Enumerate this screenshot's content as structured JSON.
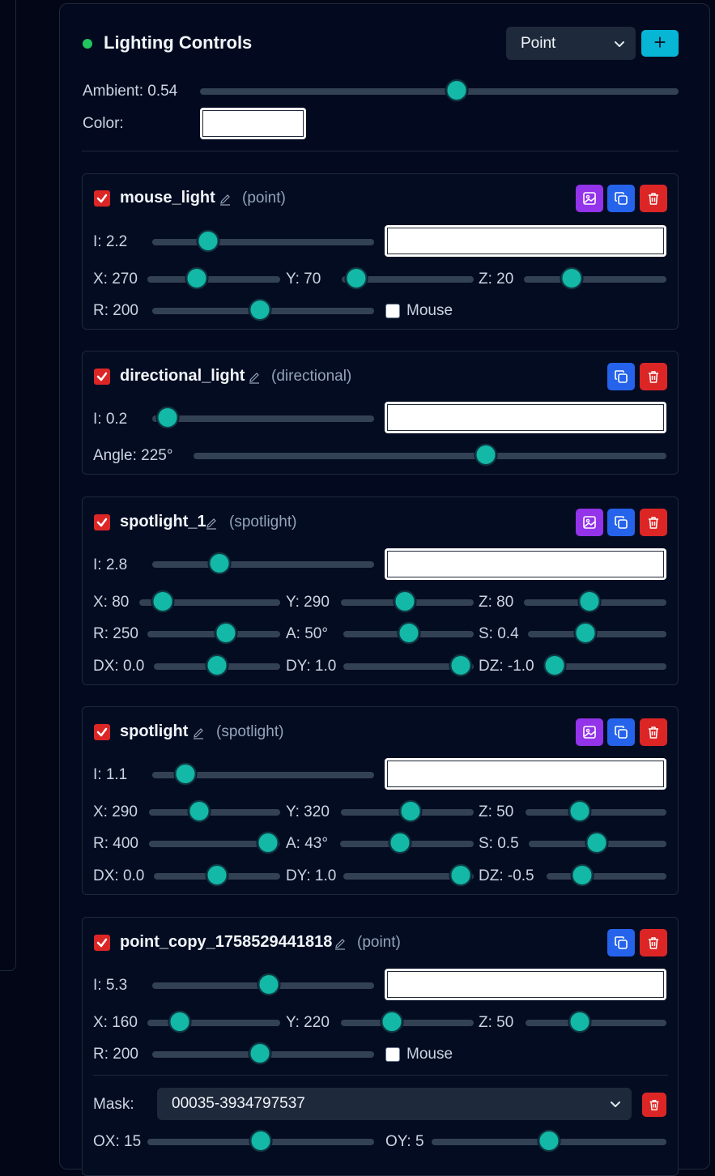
{
  "panel": {
    "title": "Lighting Controls",
    "light_type_select": "Point",
    "add_label": "+",
    "ambient_label": "Ambient: 0.54",
    "ambient_value": 0.54,
    "color_label": "Color:"
  },
  "lights": [
    {
      "name": "mouse_light",
      "type_label": "(point)",
      "intensity_label": "I: 2.2",
      "x_label": "X: 270",
      "y_label": "Y: 70",
      "z_label": "Z: 20",
      "r_label": "R: 200",
      "mouse_label": "Mouse"
    },
    {
      "name": "directional_light",
      "type_label": "(directional)",
      "intensity_label": "I: 0.2",
      "angle_label": "Angle: 225°"
    },
    {
      "name": "spotlight_1",
      "type_label": "(spotlight)",
      "intensity_label": "I: 2.8",
      "x_label": "X: 80",
      "y_label": "Y: 290",
      "z_label": "Z: 80",
      "r_label": "R: 250",
      "a_label": "A: 50°",
      "s_label": "S: 0.4",
      "dx_label": "DX: 0.0",
      "dy_label": "DY: 1.0",
      "dz_label": "DZ: -1.0"
    },
    {
      "name": "spotlight",
      "type_label": "(spotlight)",
      "intensity_label": "I: 1.1",
      "x_label": "X: 290",
      "y_label": "Y: 320",
      "z_label": "Z: 50",
      "r_label": "R: 400",
      "a_label": "A: 43°",
      "s_label": "S: 0.5",
      "dx_label": "DX: 0.0",
      "dy_label": "DY: 1.0",
      "dz_label": "DZ: -0.5"
    },
    {
      "name": "point_copy_1758529441818",
      "type_label": "(point)",
      "intensity_label": "I: 5.3",
      "x_label": "X: 160",
      "y_label": "Y: 220",
      "z_label": "Z: 50",
      "r_label": "R: 200",
      "mouse_label": "Mouse",
      "mask_label": "Mask:",
      "mask_value": "00035-3934797537",
      "ox_label": "OX: 15",
      "oy_label": "OY: 5"
    }
  ],
  "icons": {
    "enabled_checkbox": "check-icon",
    "rename": "pencil-icon",
    "image": "image-icon",
    "duplicate": "copy-icon",
    "delete": "trash-icon",
    "dropdown": "chevron-down-icon"
  },
  "colors": {
    "accent": "#06b6d4",
    "slider_thumb": "#14b8a6",
    "status_dot": "#22c55e",
    "image_button": "#9333ea",
    "duplicate_button": "#2563eb",
    "delete_button": "#dc2626"
  }
}
